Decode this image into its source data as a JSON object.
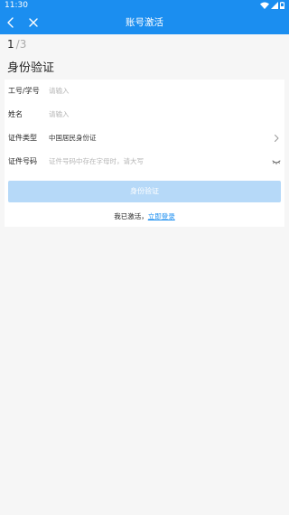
{
  "status_bar": {
    "time": "11:30",
    "icons": [
      "wifi-icon",
      "signal-icon",
      "battery-icon"
    ]
  },
  "topbar": {
    "title": "账号激活",
    "back_icon": "chevron-left-icon",
    "close_icon": "close-icon"
  },
  "steps": {
    "current": "1",
    "separator": "/",
    "total": "3"
  },
  "page_title": "身份验证",
  "form": {
    "rows": [
      {
        "label": "工号/学号",
        "value": "",
        "placeholder": "请输入"
      },
      {
        "label": "姓名",
        "value": "",
        "placeholder": "请输入"
      },
      {
        "label": "证件类型",
        "value": "中国居民身份证",
        "trailing_icon": "chevron-right-icon"
      },
      {
        "label": "证件号码",
        "value": "",
        "placeholder": "证件号码中存在字母时，请大写",
        "trailing_icon": "eye-closed-icon"
      }
    ]
  },
  "submit_label": "身份验证",
  "login_prompt": {
    "text": "我已激活，",
    "link": "立即登录"
  },
  "colors": {
    "primary": "#1b8ef0",
    "disabled_button": "#b6d9f8",
    "page_background": "#f6f6f6",
    "card_background": "#ffffff",
    "placeholder_text": "#b5b5b5"
  }
}
